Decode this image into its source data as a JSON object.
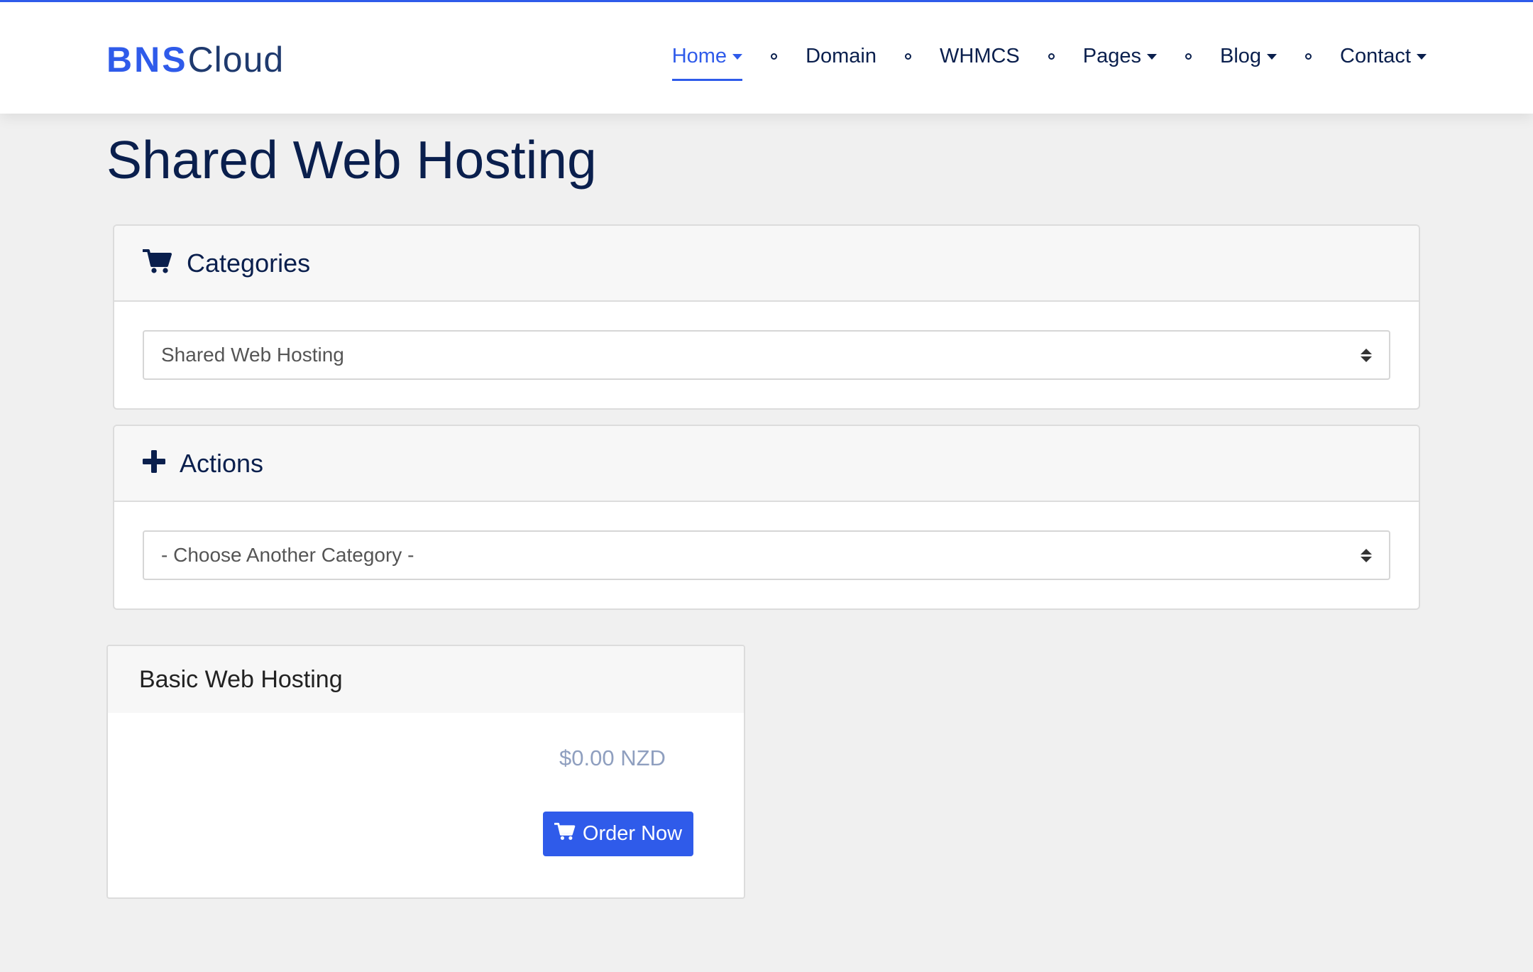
{
  "logo": {
    "bold": "BNS",
    "light": "Cloud"
  },
  "nav": {
    "items": [
      {
        "label": "Home"
      },
      {
        "label": "Domain"
      },
      {
        "label": "WHMCS"
      },
      {
        "label": "Pages"
      },
      {
        "label": "Blog"
      },
      {
        "label": "Contact"
      }
    ]
  },
  "page": {
    "title": "Shared Web Hosting"
  },
  "categories": {
    "heading": "Categories",
    "icon": "cart-icon",
    "selected": "Shared Web Hosting"
  },
  "actions": {
    "heading": "Actions",
    "icon": "plus-icon",
    "selected": "- Choose Another Category -"
  },
  "product": {
    "name": "Basic Web Hosting",
    "price": "$0.00 NZD",
    "order_label": "Order Now"
  },
  "colors": {
    "accent": "#2f5bea",
    "text": "#0a1f4d",
    "background": "#f0f0f0"
  }
}
